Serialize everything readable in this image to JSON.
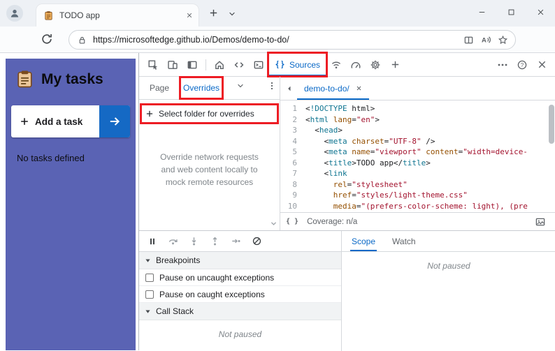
{
  "browser": {
    "tab": {
      "title": "TODO app",
      "favicon": "notepad-icon"
    },
    "tab_strip_icons": [
      "profile",
      "tab-close",
      "new-tab-plus",
      "tab-list-chevron"
    ],
    "window_controls": [
      "minimize",
      "maximize",
      "close"
    ],
    "toolbar_icons": [
      "refresh"
    ],
    "address": {
      "url": "https://microsoftedge.github.io/Demos/demo-to-do/",
      "icons": [
        "site-info-lock",
        "split-screen",
        "read-aloud",
        "favorites-star"
      ]
    }
  },
  "page": {
    "heading": "My tasks",
    "heading_icon": "notepad-icon",
    "add_task_label": "Add a task",
    "empty_state": "No tasks defined",
    "colors": {
      "sidebar": "#5a63b4",
      "add_button": "#1569c4"
    }
  },
  "devtools": {
    "colors": {
      "accent": "#0a69c7",
      "annotation": "#ed1c24"
    },
    "activity_bar": {
      "active_tab": "Sources",
      "icons": [
        "inspect",
        "device-emulation",
        "dock",
        "home",
        "elements-code",
        "console",
        "sources",
        "network",
        "performance",
        "settings-gear",
        "add-tools",
        "more-options",
        "help",
        "close"
      ]
    },
    "navigator": {
      "tabs": [
        {
          "label": "Page",
          "selected": false
        },
        {
          "label": "Overrides",
          "selected": true
        }
      ],
      "icons": [
        "chevron-down",
        "kebab-menu"
      ],
      "select_folder_label": "Select folder for overrides",
      "empty_text": "Override network requests and web content locally to mock remote resources"
    },
    "editor": {
      "file_tab": "demo-to-do/",
      "code_lines": [
        "<!DOCTYPE html>",
        "<html lang=\"en\">",
        "  <head>",
        "    <meta charset=\"UTF-8\" />",
        "    <meta name=\"viewport\" content=\"width=device-",
        "    <title>TODO app</title>",
        "    <link",
        "      rel=\"stylesheet\"",
        "      href=\"styles/light-theme.css\"",
        "      media=\"(prefers-color-scheme: light), (pre"
      ],
      "status": {
        "pretty_print": "{ }",
        "coverage": "Coverage: n/a"
      }
    },
    "debugger": {
      "toolbar_icons": [
        "pause",
        "step-over",
        "step-into",
        "step-out",
        "step",
        "deactivate-breakpoints"
      ],
      "breakpoints_title": "Breakpoints",
      "checkboxes": [
        {
          "label": "Pause on uncaught exceptions",
          "checked": false
        },
        {
          "label": "Pause on caught exceptions",
          "checked": false
        }
      ],
      "call_stack_title": "Call Stack",
      "call_stack_status": "Not paused",
      "scope_tabs": [
        {
          "label": "Scope",
          "selected": true
        },
        {
          "label": "Watch",
          "selected": false
        }
      ],
      "scope_status": "Not paused"
    }
  }
}
